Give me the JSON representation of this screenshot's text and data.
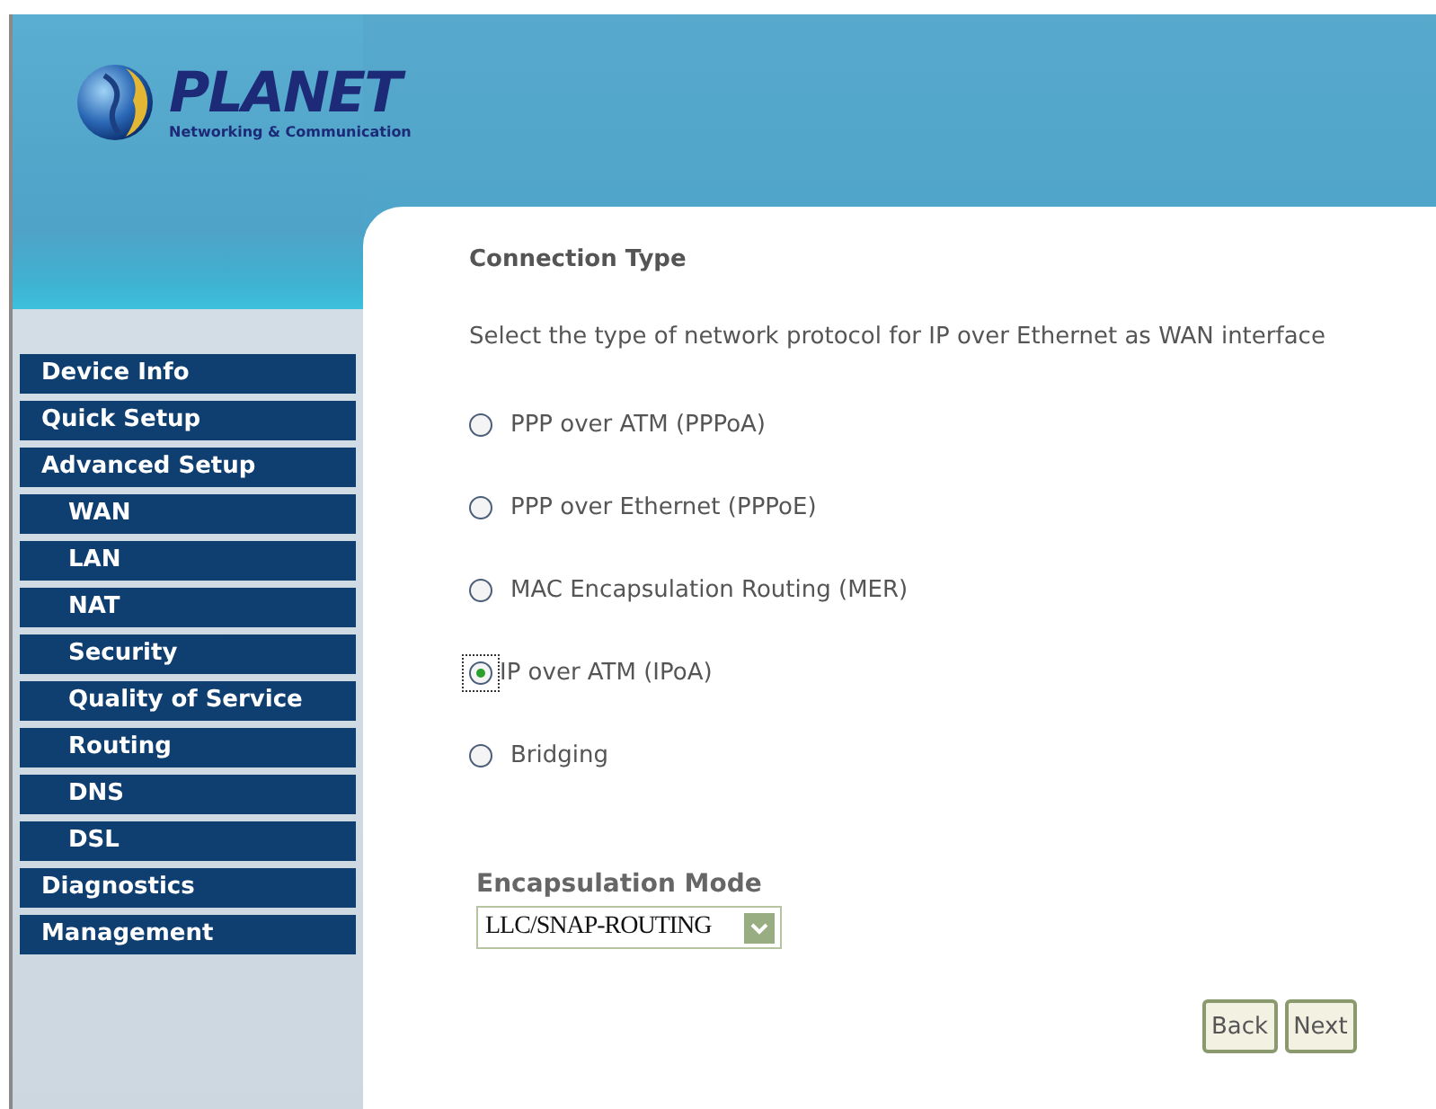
{
  "logo": {
    "brand": "PLANET",
    "tagline": "Networking & Communication"
  },
  "sidebar": {
    "items": [
      {
        "label": "Device Info"
      },
      {
        "label": "Quick Setup"
      },
      {
        "label": "Advanced Setup",
        "children": [
          {
            "label": "WAN"
          },
          {
            "label": "LAN"
          },
          {
            "label": "NAT"
          },
          {
            "label": "Security"
          },
          {
            "label": "Quality of Service"
          },
          {
            "label": "Routing"
          },
          {
            "label": "DNS"
          },
          {
            "label": "DSL"
          }
        ]
      },
      {
        "label": "Diagnostics"
      },
      {
        "label": "Management"
      }
    ]
  },
  "content": {
    "title": "Connection Type",
    "description": "Select the type of network protocol for IP over Ethernet as WAN interface",
    "options": [
      {
        "label": "PPP over ATM (PPPoA)",
        "selected": false
      },
      {
        "label": "PPP over Ethernet (PPPoE)",
        "selected": false
      },
      {
        "label": "MAC Encapsulation Routing (MER)",
        "selected": false
      },
      {
        "label": "IP over ATM (IPoA)",
        "selected": true
      },
      {
        "label": "Bridging",
        "selected": false
      }
    ],
    "encapsulation": {
      "label": "Encapsulation Mode",
      "value": "LLC/SNAP-ROUTING"
    },
    "buttons": [
      "Back",
      "Next"
    ]
  }
}
